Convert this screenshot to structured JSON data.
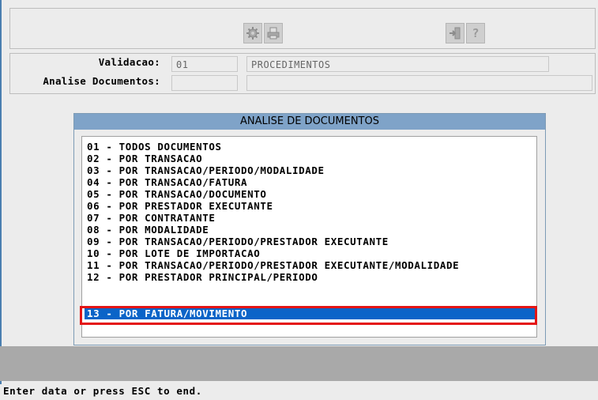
{
  "toolbar": {
    "icons": [
      "settings-gear-icon",
      "print-icon",
      "exit-door-icon",
      "help-question-icon"
    ],
    "help_glyph": "?"
  },
  "fields": {
    "validacao_label": "Validacao:",
    "validacao_code": "01",
    "validacao_desc": "PROCEDIMENTOS",
    "analise_label": "Analise Documentos:",
    "analise_code": "",
    "analise_desc": ""
  },
  "dialog": {
    "title": "ANALISE DE DOCUMENTOS",
    "items": [
      "01 - TODOS DOCUMENTOS",
      "02 - POR TRANSACAO",
      "03 - POR TRANSACAO/PERIODO/MODALIDADE",
      "04 - POR TRANSACAO/FATURA",
      "05 - POR TRANSACAO/DOCUMENTO",
      "06 - POR PRESTADOR EXECUTANTE",
      "07 - POR CONTRATANTE",
      "08 - POR MODALIDADE",
      "09 - POR TRANSACAO/PERIODO/PRESTADOR EXECUTANTE",
      "10 - POR LOTE DE IMPORTACAO",
      "11 - POR TRANSACAO/PERIODO/PRESTADOR EXECUTANTE/MODALIDADE",
      "12 - POR PRESTADOR PRINCIPAL/PERIODO",
      "13 - POR FATURA/MOVIMENTO"
    ],
    "selected_index": 12
  },
  "status": {
    "message": "Enter data or press ESC to end."
  },
  "colors": {
    "selection": "#0a64c8",
    "title_bar": "#7fa3c8",
    "highlight_box": "#e41515"
  }
}
